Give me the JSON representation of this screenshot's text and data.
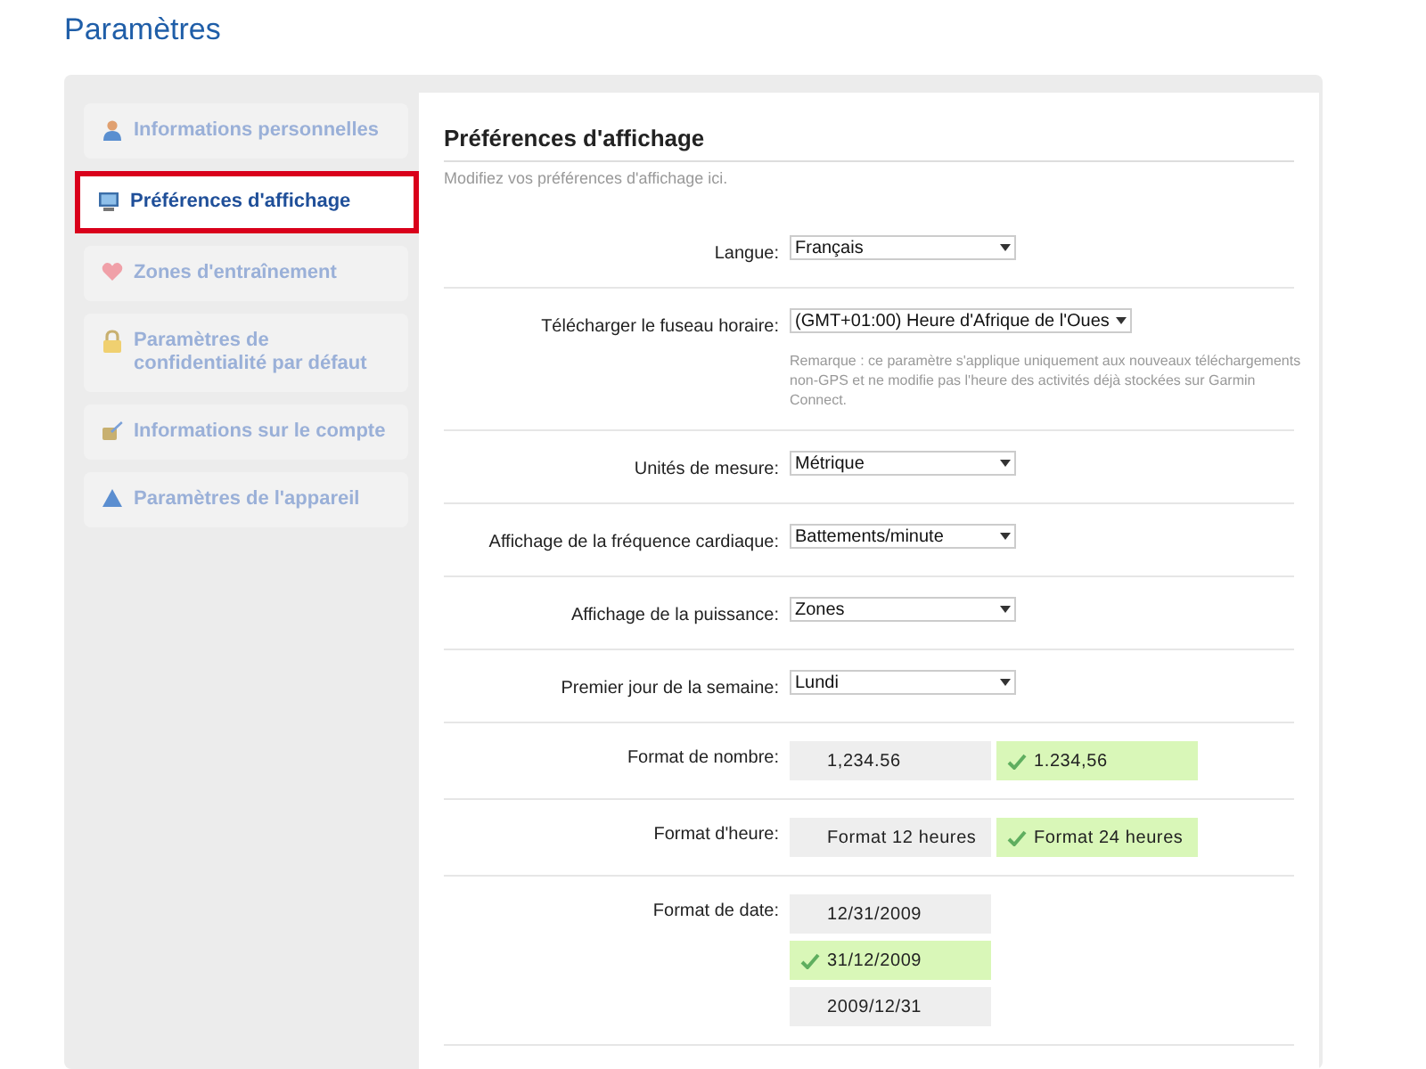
{
  "page": {
    "title": "Paramètres"
  },
  "sidebar": {
    "items": [
      {
        "label": "Informations personnelles",
        "selected": false
      },
      {
        "label": "Préférences d'affichage",
        "selected": true
      },
      {
        "label": "Zones d'entraînement",
        "selected": false
      },
      {
        "label": "Paramètres de confidentialité par défaut",
        "selected": false
      },
      {
        "label": "Informations sur le compte",
        "selected": false
      },
      {
        "label": "Paramètres de l'appareil",
        "selected": false
      }
    ]
  },
  "content": {
    "heading": "Préférences d'affichage",
    "subtitle": "Modifiez vos préférences d'affichage ici.",
    "settings": [
      {
        "kind": "select",
        "label": "Langue:",
        "value": "Français"
      },
      {
        "kind": "select",
        "label": "Télécharger le fuseau horaire:",
        "value": "(GMT+01:00) Heure d'Afrique de l'Oues",
        "note": "Remarque : ce paramètre s'applique uniquement aux nouveaux téléchargements non-GPS et ne modifie pas l'heure des activités déjà stockées sur Garmin Connect."
      },
      {
        "kind": "select",
        "label": "Unités de mesure:",
        "value": "Métrique"
      },
      {
        "kind": "select",
        "label": "Affichage de la fréquence cardiaque:",
        "value": "Battements/minute"
      },
      {
        "kind": "select",
        "label": "Affichage de la puissance:",
        "value": "Zones"
      },
      {
        "kind": "select",
        "label": "Premier jour de la semaine:",
        "value": "Lundi"
      },
      {
        "kind": "choice_row",
        "label": "Format de nombre:",
        "options": [
          {
            "label": "1,234.56",
            "selected": false
          },
          {
            "label": "1.234,56",
            "selected": true
          }
        ]
      },
      {
        "kind": "choice_row",
        "label": "Format d'heure:",
        "options": [
          {
            "label": "Format 12 heures",
            "selected": false
          },
          {
            "label": "Format 24 heures",
            "selected": true
          }
        ]
      },
      {
        "kind": "choice_column",
        "label": "Format de date:",
        "options": [
          {
            "label": "12/31/2009",
            "selected": false
          },
          {
            "label": "31/12/2009",
            "selected": true
          },
          {
            "label": "2009/12/31",
            "selected": false
          }
        ]
      }
    ]
  }
}
